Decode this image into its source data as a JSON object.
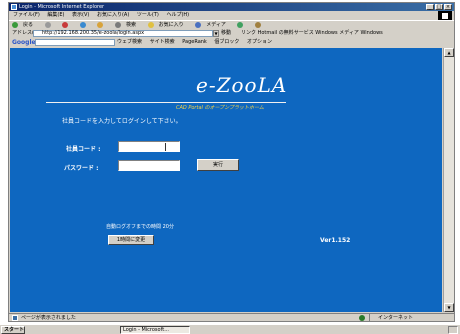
{
  "window": {
    "title": "Login - Microsoft Internet Explorer"
  },
  "menubar": {
    "items": [
      "ファイル(F)",
      "編集(E)",
      "表示(V)",
      "お気に入り(A)",
      "ツール(T)",
      "ヘルプ(H)"
    ]
  },
  "toolbar": {
    "back": "戻る",
    "search": "検索",
    "favorites": "お気に入り",
    "media": "メディア"
  },
  "address": {
    "label": "アドレス(D)",
    "url": "http://192.168.200.35/e-zoola/login.aspx",
    "go": "移動",
    "links_label": "リンク",
    "links": [
      "Hotmail の無料サービス",
      "Windows メディア",
      "Windows"
    ]
  },
  "googlebar": {
    "logo": "Google",
    "search_label": "ウェブ検索",
    "site_search": "サイト検索",
    "pagerank": "PageRank",
    "blocked": "個ブロック",
    "options": "オプション"
  },
  "page": {
    "brand": "e-ZooLA",
    "tagline": "CAD Portal のオープンプラットホーム",
    "instruction": "社員コードを入力してログインして下さい。",
    "employee_code_label": "社員コード :",
    "password_label": "パスワード :",
    "employee_code_value": "",
    "password_value": "",
    "submit_label": "実行",
    "autologout_text": "自動ログオフまでの時間 20分",
    "extend_label": "1時間に変更",
    "version": "Ver1.152"
  },
  "statusbar": {
    "text": "ページが表示されました",
    "zone": "インターネット"
  },
  "taskbar": {
    "start": "スタート",
    "tasks": [
      "Login - Microsoft..."
    ],
    "tray_time": ""
  },
  "colors": {
    "content_bg": "#0e67c0",
    "tagline": "#f7d545"
  }
}
